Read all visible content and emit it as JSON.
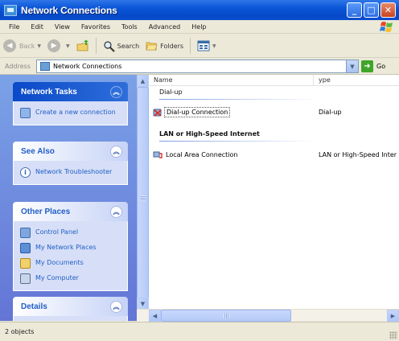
{
  "window": {
    "title": "Network Connections"
  },
  "menu": [
    "File",
    "Edit",
    "View",
    "Favorites",
    "Tools",
    "Advanced",
    "Help"
  ],
  "toolbar": {
    "back": "Back",
    "search": "Search",
    "folders": "Folders"
  },
  "address": {
    "label": "Address",
    "value": "Network Connections",
    "go": "Go"
  },
  "tasks": {
    "network_tasks": {
      "title": "Network Tasks",
      "links": [
        "Create a new connection"
      ]
    },
    "see_also": {
      "title": "See Also",
      "links": [
        "Network Troubleshooter"
      ]
    },
    "other_places": {
      "title": "Other Places",
      "links": [
        "Control Panel",
        "My Network Places",
        "My Documents",
        "My Computer"
      ]
    },
    "details": {
      "title": "Details"
    }
  },
  "list": {
    "columns": {
      "name": "Name",
      "type": "ype"
    },
    "groups": [
      {
        "label": "Dial-up",
        "items": [
          {
            "name": "Dial-up Connection",
            "type": "Dial-up",
            "icon": "dialup-icon"
          }
        ]
      },
      {
        "label": "LAN or High-Speed Internet",
        "items": [
          {
            "name": "Local Area Connection",
            "type": "LAN or High-Speed Inter",
            "icon": "lan-icon"
          }
        ]
      }
    ]
  },
  "status": {
    "text": "2 objects"
  },
  "colors": {
    "title_bar": "#0A55D8",
    "task_link": "#215DC6",
    "left_pane": "#6F8EDD"
  }
}
